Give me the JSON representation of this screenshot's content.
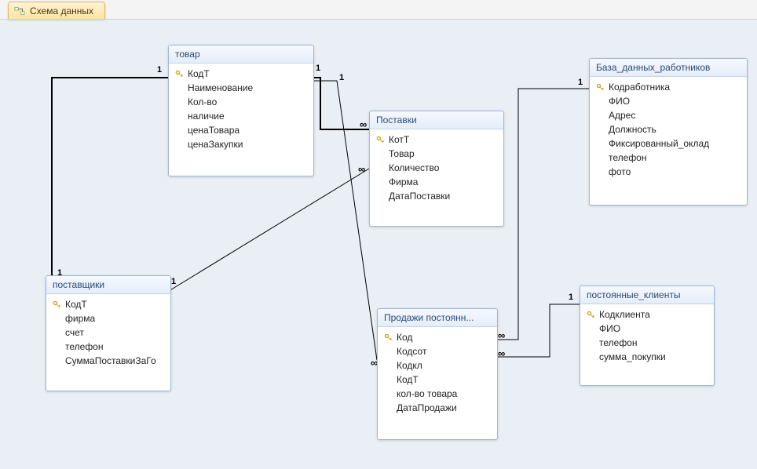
{
  "tab": {
    "title": "Схема данных"
  },
  "entities": {
    "tovar": {
      "title": "товар",
      "fields": [
        {
          "name": "КодТ",
          "pk": true
        },
        {
          "name": "Наименование"
        },
        {
          "name": "Кол-во"
        },
        {
          "name": "наличие"
        },
        {
          "name": "ценаТовара"
        },
        {
          "name": "ценаЗакупки"
        }
      ]
    },
    "postavki": {
      "title": "Поставки",
      "fields": [
        {
          "name": "КотТ",
          "pk": true
        },
        {
          "name": "Товар"
        },
        {
          "name": "Количество"
        },
        {
          "name": "Фирма"
        },
        {
          "name": "ДатаПоставки"
        }
      ]
    },
    "workers": {
      "title": "База_данных_работников",
      "fields": [
        {
          "name": "Кодработника",
          "pk": true
        },
        {
          "name": "ФИО"
        },
        {
          "name": "Адрес"
        },
        {
          "name": "Должность"
        },
        {
          "name": "Фиксированный_оклад"
        },
        {
          "name": "телефон"
        },
        {
          "name": "фото"
        }
      ]
    },
    "suppliers": {
      "title": "поставщики",
      "fields": [
        {
          "name": "КодТ",
          "pk": true
        },
        {
          "name": "фирма"
        },
        {
          "name": "счет"
        },
        {
          "name": "телефон"
        },
        {
          "name": "СуммаПоставкиЗаГо"
        }
      ]
    },
    "sales": {
      "title": "Продажи постоянн...",
      "fields": [
        {
          "name": "Код",
          "pk": true
        },
        {
          "name": "Кодсот"
        },
        {
          "name": "Кодкл"
        },
        {
          "name": "КодТ"
        },
        {
          "name": "кол-во товара"
        },
        {
          "name": "ДатаПродажи"
        }
      ]
    },
    "clients": {
      "title": "постоянные_клиенты",
      "fields": [
        {
          "name": "Кодклиента",
          "pk": true
        },
        {
          "name": "ФИО"
        },
        {
          "name": "телефон"
        },
        {
          "name": "сумма_покупки"
        }
      ]
    }
  },
  "relationships": [
    {
      "from": "поставщики.КодТ",
      "to": "товар.КодТ",
      "left_card": "1",
      "right_card": "1"
    },
    {
      "from": "товар.КодТ",
      "to": "Поставки.КотТ",
      "left_card": "1",
      "right_card": "∞"
    },
    {
      "from": "поставщики.КодТ",
      "to": "Поставки.Фирма",
      "left_card": "1",
      "right_card": "∞"
    },
    {
      "from": "товар.КодТ",
      "to": "Продажи.КодТ",
      "left_card": "1",
      "right_card": "∞"
    },
    {
      "from": "База_данных_работников.Кодработника",
      "to": "Продажи.Кодсот",
      "left_card": "1",
      "right_card": "∞"
    },
    {
      "from": "постоянные_клиенты.Кодклиента",
      "to": "Продажи.Кодкл",
      "left_card": "1",
      "right_card": "∞"
    }
  ],
  "colors": {
    "accent": "#a0b6d4",
    "title_text": "#2a4a78",
    "tab_grad_top": "#fff3d6",
    "tab_grad_bot": "#ffe2a0"
  }
}
